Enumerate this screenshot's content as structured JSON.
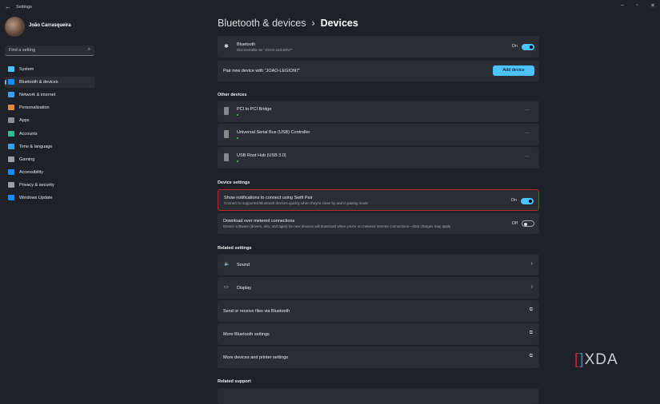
{
  "window": {
    "title": "Settings"
  },
  "user": {
    "name": "João Carrasqueira"
  },
  "search": {
    "placeholder": "Find a setting"
  },
  "sidebar": {
    "items": [
      {
        "label": "System",
        "color": "#4cc2ff"
      },
      {
        "label": "Bluetooth & devices",
        "color": "#1a8cff"
      },
      {
        "label": "Network & internet",
        "color": "#3a9ff0"
      },
      {
        "label": "Personalization",
        "color": "#e08a3c"
      },
      {
        "label": "Apps",
        "color": "#8a8f9a"
      },
      {
        "label": "Accounts",
        "color": "#2fbf8f"
      },
      {
        "label": "Time & language",
        "color": "#3aa0e0"
      },
      {
        "label": "Gaming",
        "color": "#9aa0aa"
      },
      {
        "label": "Accessibility",
        "color": "#1a8cff"
      },
      {
        "label": "Privacy & security",
        "color": "#9aa0aa"
      },
      {
        "label": "Windows Update",
        "color": "#1a8cff"
      }
    ]
  },
  "breadcrumb": {
    "parent": "Bluetooth & devices",
    "sep": "›",
    "current": "Devices"
  },
  "bluetooth": {
    "title": "Bluetooth",
    "subtitle": "Discoverable as \"JOAO-LEGION7\"",
    "state": "On"
  },
  "pair": {
    "label": "Pair new device with \"JOAO-LEGION7\"",
    "button": "Add device"
  },
  "other_devices": {
    "heading": "Other devices",
    "items": [
      {
        "name": "PCI to PCI Bridge"
      },
      {
        "name": "Universal Serial Bus (USB) Controller"
      },
      {
        "name": "USB Root Hub (USB 3.0)"
      }
    ],
    "more": "···"
  },
  "device_settings": {
    "heading": "Device settings",
    "swift_pair": {
      "title": "Show notifications to connect using Swift Pair",
      "subtitle": "Connect to supported Bluetooth devices quickly when they're close by and in pairing mode",
      "state": "On"
    },
    "metered": {
      "title": "Download over metered connections",
      "subtitle": "Device software (drivers, info, and apps) for new devices will download when you're on metered internet connections—data charges may apply",
      "state": "Off"
    }
  },
  "related_settings": {
    "heading": "Related settings",
    "items": [
      {
        "label": "Sound"
      },
      {
        "label": "Display"
      },
      {
        "label": "Send or receive files via Bluetooth"
      },
      {
        "label": "More Bluetooth settings"
      },
      {
        "label": "More devices and printer settings"
      }
    ]
  },
  "related_support": {
    "heading": "Related support"
  },
  "watermark": "XDA"
}
